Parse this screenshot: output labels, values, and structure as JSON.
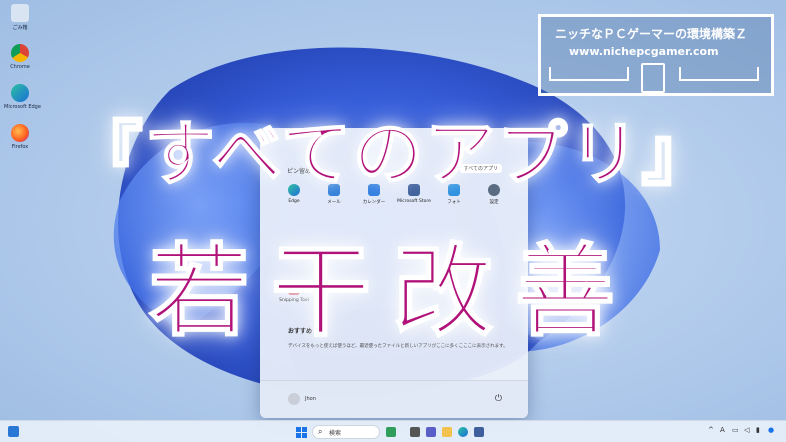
{
  "desktop": {
    "icons": [
      {
        "name": "ごみ箱"
      },
      {
        "name": "Chrome"
      },
      {
        "name": "Microsoft Edge"
      },
      {
        "name": "Firefox"
      }
    ]
  },
  "banner": {
    "line1": "『すべてのアプリ』",
    "line2": "若干改善"
  },
  "logo": {
    "line1": "ニッチなＰＣゲーマーの環境構築Ｚ",
    "line2": "www.nichepcgamer.com"
  },
  "start_menu": {
    "pinned_header": "ピン留め",
    "all_apps_label": "すべてのアプリ",
    "apps": [
      {
        "name": "Edge",
        "color": "#1b8fd9"
      },
      {
        "name": "メール",
        "color": "#2c7cd8"
      },
      {
        "name": "カレンダー",
        "color": "#2f7de0"
      },
      {
        "name": "Microsoft Store",
        "color": "#3d5f9c"
      },
      {
        "name": "フォト",
        "color": "#2a8fe0"
      },
      {
        "name": "設定",
        "color": "#5a6a80"
      },
      {
        "name": "Snipping Tool",
        "color": "#d14f6a"
      }
    ],
    "recommended_header": "おすすめ",
    "recommended_message": "デバイスをもっと使えば使うほど、最近使ったファイルと新しいアプリがここに多くこここに表示されます。",
    "user_name": "Jhon",
    "power_icon": "power-icon"
  },
  "taskbar": {
    "search_label": "検索",
    "tray": {
      "lang": "A"
    }
  },
  "colors": {
    "title": "#b0127a",
    "accent": "#2a78d6"
  }
}
